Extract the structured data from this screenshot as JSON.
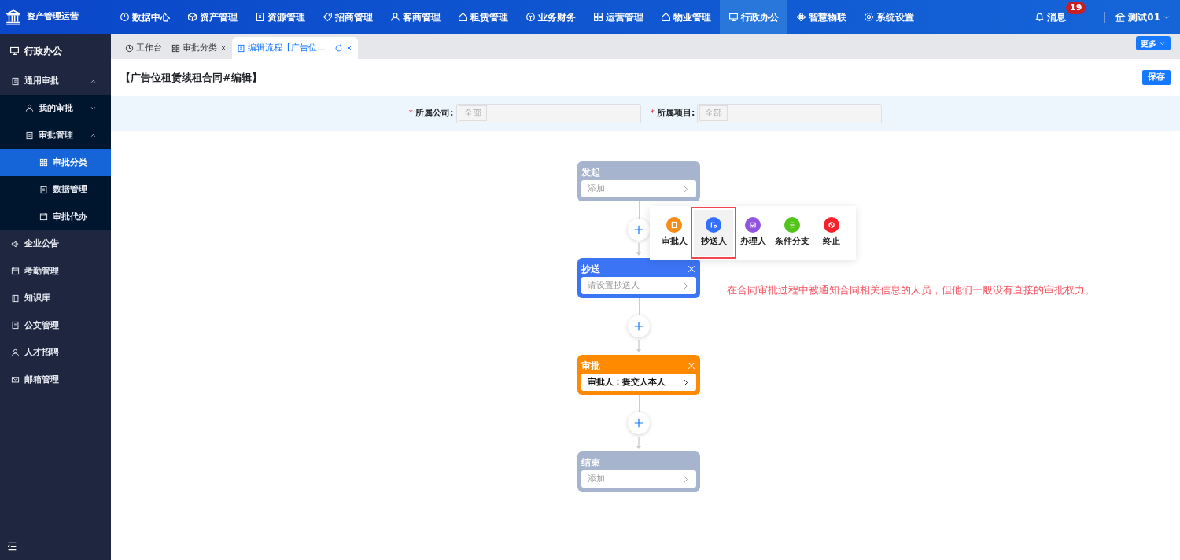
{
  "app": {
    "title": "资产管理运营"
  },
  "top_nav": [
    {
      "label": "数据中心",
      "selected": false
    },
    {
      "label": "资产管理",
      "selected": false
    },
    {
      "label": "资源管理",
      "selected": false
    },
    {
      "label": "招商管理",
      "selected": false
    },
    {
      "label": "客商管理",
      "selected": false
    },
    {
      "label": "租赁管理",
      "selected": false
    },
    {
      "label": "业务财务",
      "selected": false
    },
    {
      "label": "运营管理",
      "selected": false
    },
    {
      "label": "物业管理",
      "selected": false
    },
    {
      "label": "行政办公",
      "selected": true
    },
    {
      "label": "智慧物联",
      "selected": false
    },
    {
      "label": "系统设置",
      "selected": false
    }
  ],
  "messages": {
    "label": "消息",
    "badge": "19"
  },
  "user": {
    "name": "测试01"
  },
  "sidebar": {
    "title": "行政办公",
    "items": [
      {
        "label": "通用审批",
        "expanded": true,
        "selected": false,
        "children": [
          {
            "label": "我的审批",
            "expanded": false,
            "selected": false
          },
          {
            "label": "审批管理",
            "expanded": true,
            "selected": false,
            "children": [
              {
                "label": "审批分类",
                "selected": true
              },
              {
                "label": "数据管理",
                "selected": false
              },
              {
                "label": "审批代办",
                "selected": false
              }
            ]
          }
        ]
      },
      {
        "label": "企业公告",
        "selected": false
      },
      {
        "label": "考勤管理",
        "selected": false
      },
      {
        "label": "知识库",
        "selected": false
      },
      {
        "label": "公文管理",
        "selected": false
      },
      {
        "label": "人才招聘",
        "selected": false
      },
      {
        "label": "邮箱管理",
        "selected": false
      }
    ]
  },
  "tabs": [
    {
      "label": "工作台",
      "selected": false,
      "closable": false,
      "refreshable": false
    },
    {
      "label": "审批分类",
      "selected": false,
      "closable": true,
      "refreshable": false
    },
    {
      "label": "编辑流程【广告位...",
      "selected": true,
      "closable": true,
      "refreshable": true
    }
  ],
  "more_button": "更多",
  "page": {
    "title": "【广告位租赁续租合同#编辑】",
    "save_button": "保存"
  },
  "filters": [
    {
      "required_mark": "*",
      "label": "所属公司:",
      "tag": "全部"
    },
    {
      "required_mark": "*",
      "label": "所属项目:",
      "tag": "全部"
    }
  ],
  "flow": [
    {
      "kind": "start",
      "title": "发起",
      "closable": false,
      "placeholder": "添加"
    },
    {
      "kind": "cc",
      "title": "抄送",
      "closable": true,
      "placeholder": "请设置抄送人"
    },
    {
      "kind": "approver",
      "title": "审批",
      "closable": true,
      "value": "审批人：提交人本人"
    },
    {
      "kind": "end",
      "title": "结束",
      "closable": false,
      "placeholder": "添加"
    }
  ],
  "add_menu": [
    {
      "label": "审批人",
      "color": "#fa8c16",
      "selected": false
    },
    {
      "label": "抄送人",
      "color": "#3370ff",
      "selected": true
    },
    {
      "label": "办理人",
      "color": "#9254de",
      "selected": false
    },
    {
      "label": "条件分支",
      "color": "#52c41a",
      "selected": false
    },
    {
      "label": "终止",
      "color": "#f5222d",
      "selected": false
    }
  ],
  "annotation": "在合同审批过程中被通知合同相关信息的人员，但他们一般没有直接的审批权力。"
}
